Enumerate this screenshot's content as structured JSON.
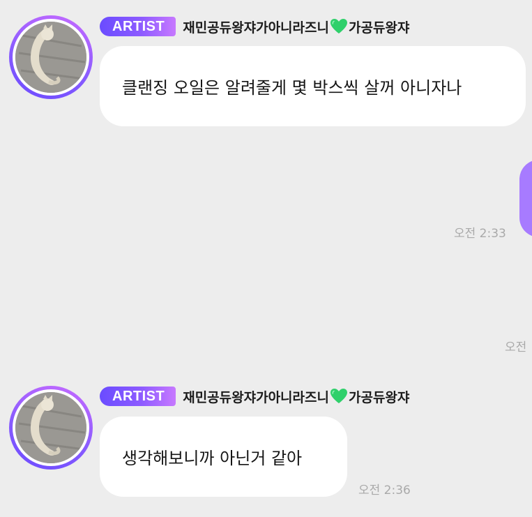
{
  "messages": [
    {
      "sender_badge": "ARTIST",
      "sender_name_before_heart": "재민공듀왕쟈가아니라즈니",
      "sender_name_after_heart": "가공듀왕쟈",
      "text": "클랜징 오일은 알려줄게 몇 박스씩 살꺼 아니자나"
    },
    {
      "mine": true,
      "time": "오전 2:33"
    },
    {
      "time": "오전"
    },
    {
      "sender_badge": "ARTIST",
      "sender_name_before_heart": "재민공듀왕쟈가아니라즈니",
      "sender_name_after_heart": "가공듀왕쟈",
      "text": "생각해보니까 아닌거 같아",
      "time": "오전 2:36"
    }
  ],
  "icons": {
    "heart": "green-heart-icon",
    "avatar": "cat-photo-avatar"
  },
  "colors": {
    "background": "#ededed",
    "bubble": "#ffffff",
    "my_bubble": "#a77bff",
    "badge_start": "#6a4cff",
    "badge_end": "#c779ff",
    "heart": "#2fd06b",
    "timestamp": "#a9a9a9"
  }
}
